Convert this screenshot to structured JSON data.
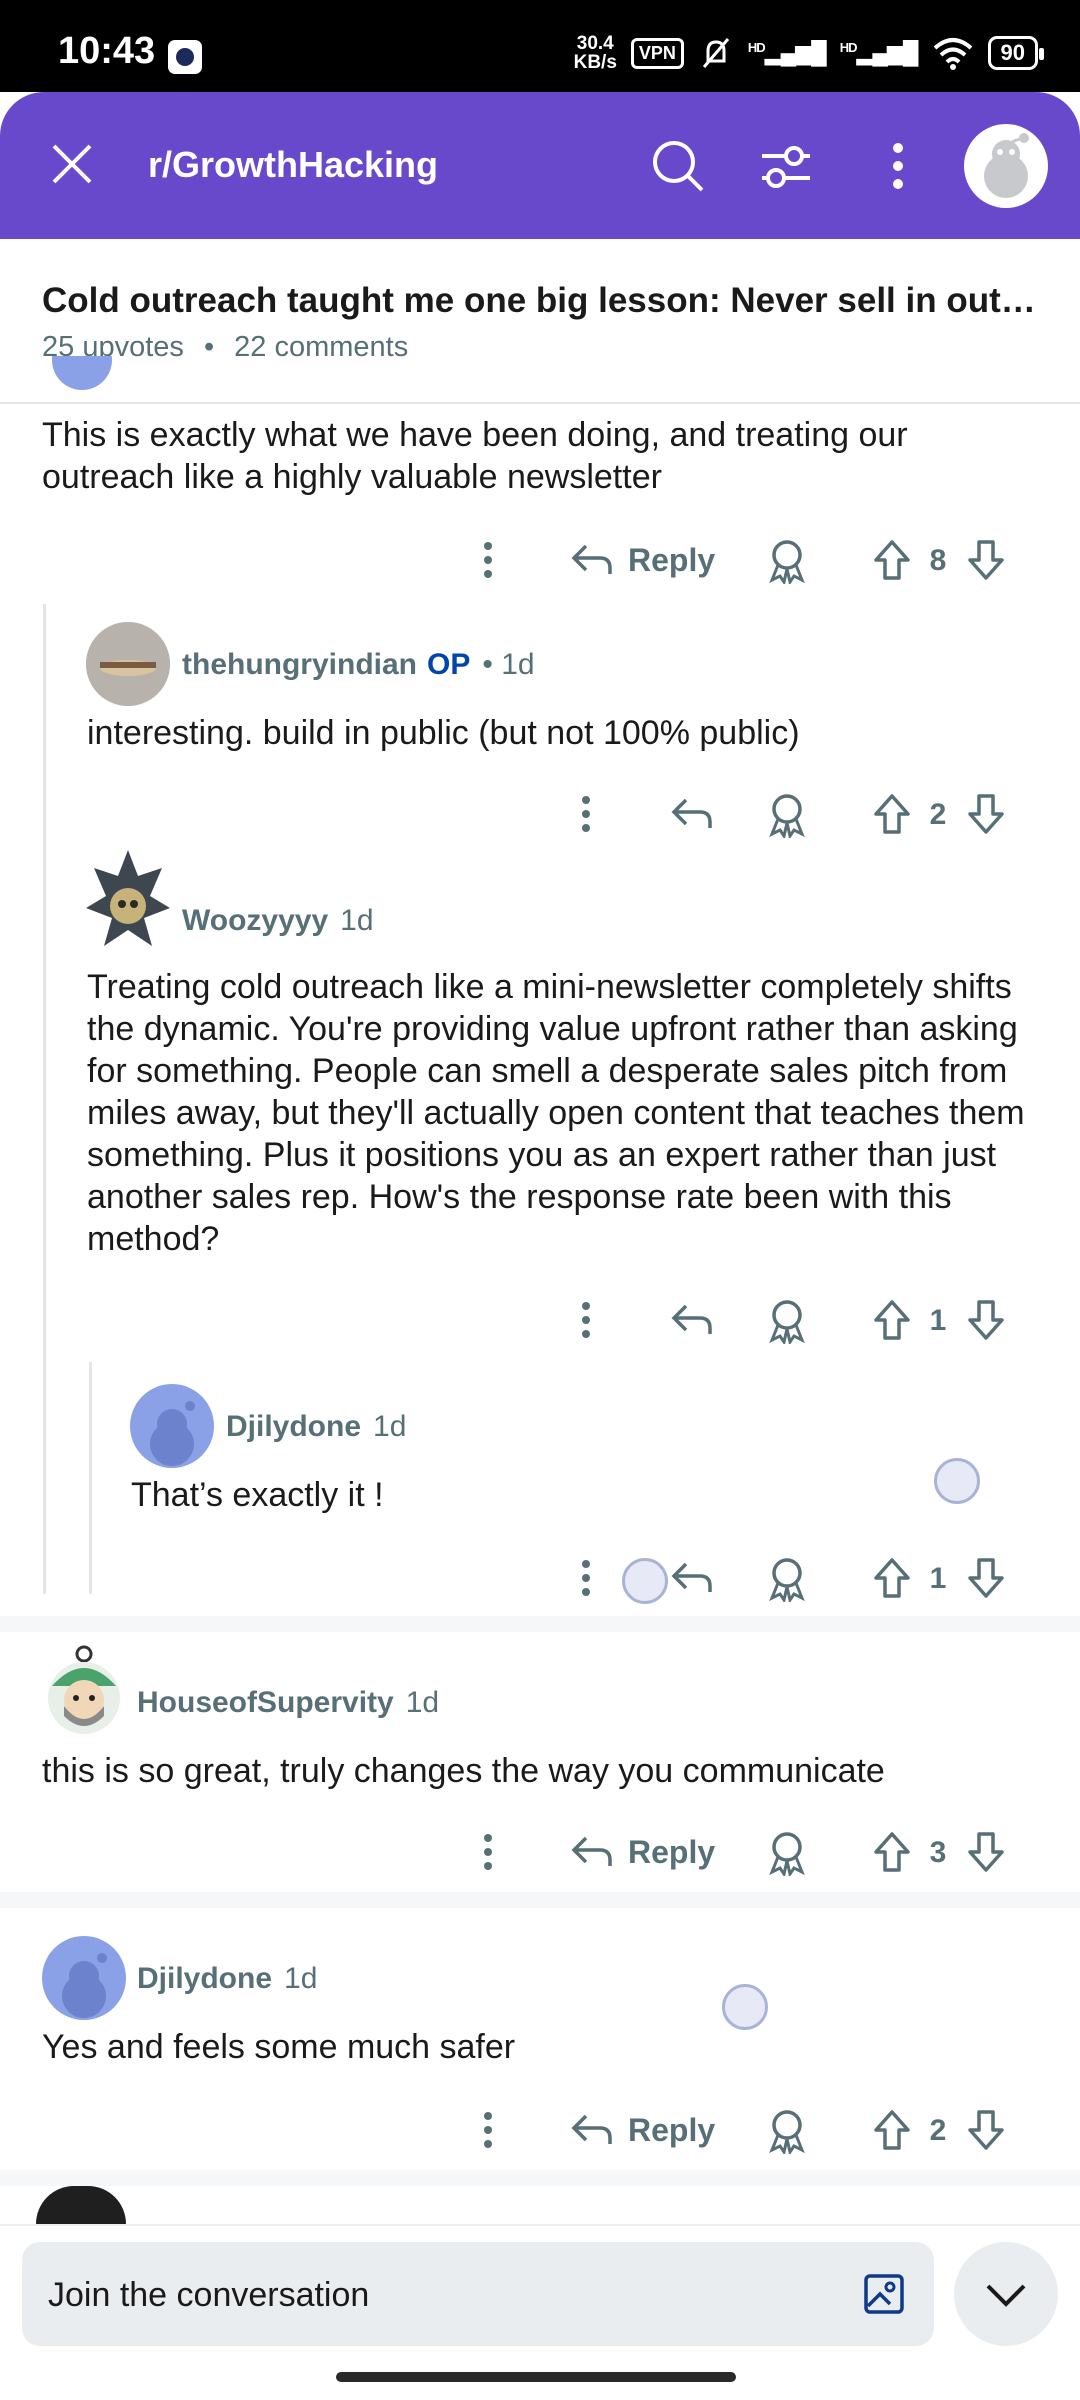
{
  "status_bar": {
    "time": "10:43",
    "net_speed_value": "30.4",
    "net_speed_unit": "KB/s",
    "vpn": "VPN",
    "signal1": "HD",
    "signal2": "HD",
    "battery": "90"
  },
  "header": {
    "subreddit": "r/GrowthHacking",
    "bg_color": "#6849cc"
  },
  "post": {
    "title": "Cold outreach taught me one big lesson: Never sell in outreach",
    "upvotes": "25 upvotes",
    "separator": "•",
    "comments": "22 comments"
  },
  "comments": [
    {
      "author": "",
      "age": "",
      "body": "This is exactly what we have been doing, and treating our outreach like a highly valuable newsletter",
      "reply_label": "Reply",
      "votes": "8"
    },
    {
      "author": "thehungryindian",
      "op_badge": "OP",
      "age": "• 1d",
      "body": "interesting. build in public (but not 100% public)",
      "votes": "2"
    },
    {
      "author": "Woozyyyy",
      "age": "1d",
      "body": "Treating cold outreach like a mini-newsletter completely shifts the dynamic. You're providing value upfront rather than asking for something. People can smell a desperate sales pitch from miles away, but they'll actually open content that teaches them something. Plus it positions you as an expert rather than just another sales rep. How's the response rate been with this method?",
      "votes": "1"
    },
    {
      "author": "Djilydone",
      "age": "1d",
      "body": "That’s exactly it !",
      "votes": "1"
    },
    {
      "author": "HouseofSupervity",
      "age": "1d",
      "body": "this is so great, truly changes the way you communicate",
      "reply_label": "Reply",
      "votes": "3"
    },
    {
      "author": "Djilydone",
      "age": "1d",
      "body": "Yes and feels some much safer",
      "reply_label": "Reply",
      "votes": "2"
    }
  ],
  "composer": {
    "placeholder": "Join the conversation"
  }
}
